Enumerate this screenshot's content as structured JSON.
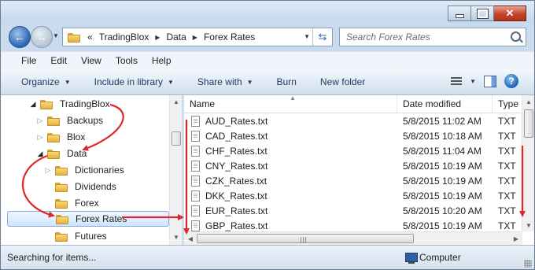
{
  "address": {
    "prefix": "«",
    "breadcrumbs": [
      "TradingBlox",
      "Data",
      "Forex Rates"
    ]
  },
  "search": {
    "placeholder": "Search Forex Rates"
  },
  "menu": [
    "File",
    "Edit",
    "View",
    "Tools",
    "Help"
  ],
  "commands": {
    "organize": "Organize",
    "include": "Include in library",
    "share": "Share with",
    "burn": "Burn",
    "new_folder": "New folder"
  },
  "tree": [
    {
      "label": "TradingBlox",
      "state": "open"
    },
    {
      "label": "Backups",
      "state": "closed"
    },
    {
      "label": "Blox",
      "state": "closed"
    },
    {
      "label": "Data",
      "state": "open"
    },
    {
      "label": "Dictionaries",
      "state": "closed"
    },
    {
      "label": "Dividends",
      "state": "none"
    },
    {
      "label": "Forex",
      "state": "none"
    },
    {
      "label": "Forex Rates",
      "state": "none",
      "selected": true
    },
    {
      "label": "Futures",
      "state": "none"
    }
  ],
  "columns": {
    "name": "Name",
    "date": "Date modified",
    "type": "Type"
  },
  "files": [
    {
      "name": "AUD_Rates.txt",
      "date": "5/8/2015 11:02 AM",
      "type": "TXT"
    },
    {
      "name": "CAD_Rates.txt",
      "date": "5/8/2015 10:18 AM",
      "type": "TXT"
    },
    {
      "name": "CHF_Rates.txt",
      "date": "5/8/2015 11:04 AM",
      "type": "TXT"
    },
    {
      "name": "CNY_Rates.txt",
      "date": "5/8/2015 10:19 AM",
      "type": "TXT"
    },
    {
      "name": "CZK_Rates.txt",
      "date": "5/8/2015 10:19 AM",
      "type": "TXT"
    },
    {
      "name": "DKK_Rates.txt",
      "date": "5/8/2015 10:19 AM",
      "type": "TXT"
    },
    {
      "name": "EUR_Rates.txt",
      "date": "5/8/2015 10:20 AM",
      "type": "TXT"
    },
    {
      "name": "GBP_Rates.txt",
      "date": "5/8/2015 10:19 AM",
      "type": "TXT"
    }
  ],
  "status": {
    "text": "Searching for items...",
    "location": "Computer"
  },
  "colors": {
    "annotation": "#e0262a",
    "selection": "#cfe4fb",
    "chrome": "#c9dbee"
  }
}
